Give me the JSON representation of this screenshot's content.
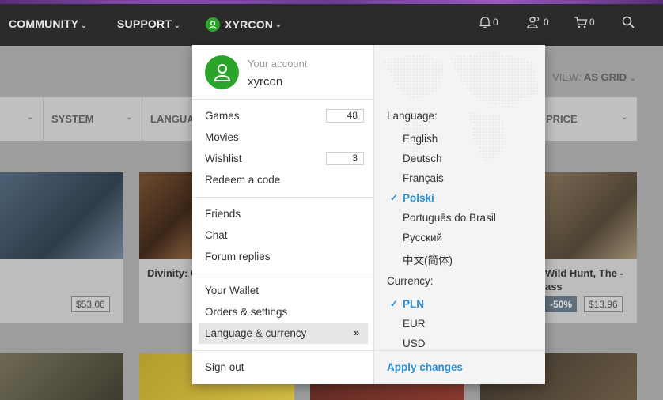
{
  "nav": {
    "community": "COMMUNITY",
    "support": "SUPPORT",
    "user": "XYRCON",
    "notifications_count": "0",
    "friends_count": "0",
    "cart_count": "0"
  },
  "page": {
    "view_as_label": "VIEW:",
    "view_as_value": "AS GRID",
    "filters": [
      "SYSTEM",
      "LANGUA",
      "PRICE"
    ],
    "cards": [
      {
        "title": "Divinity: O",
        "price": ""
      },
      {
        "title": "Wild Hunt, The - ",
        "title2": "ass",
        "discount": "-50%",
        "price": "$13.96"
      },
      {
        "price": "$53.06"
      }
    ]
  },
  "account": {
    "label": "Your account",
    "username": "xyrcon",
    "menu": {
      "games": "Games",
      "games_count": "48",
      "movies": "Movies",
      "wishlist": "Wishlist",
      "wishlist_count": "3",
      "redeem": "Redeem a code",
      "friends": "Friends",
      "chat": "Chat",
      "forum": "Forum replies",
      "wallet": "Your Wallet",
      "orders": "Orders & settings",
      "language_currency": "Language & currency",
      "signout": "Sign out"
    }
  },
  "settings": {
    "language_label": "Language:",
    "languages": [
      "English",
      "Deutsch",
      "Français",
      "Polski",
      "Português do Brasil",
      "Русский",
      "中文(简体)"
    ],
    "selected_language": "Polski",
    "currency_label": "Currency:",
    "currencies": [
      "PLN",
      "EUR",
      "USD"
    ],
    "selected_currency": "PLN",
    "apply": "Apply changes"
  },
  "colors": {
    "accent": "#2a8fd4",
    "brand_green": "#2aa52a",
    "topbar": "#2b2b2b"
  }
}
